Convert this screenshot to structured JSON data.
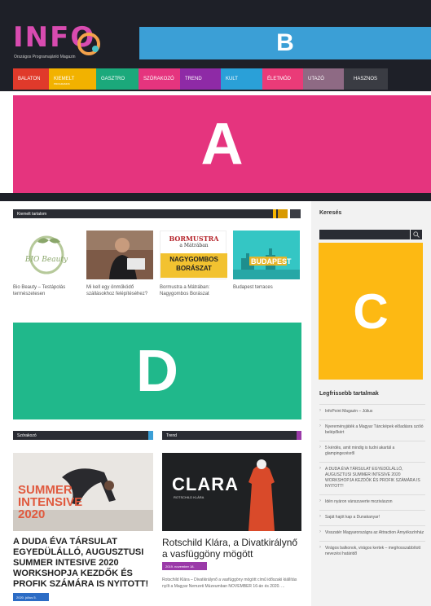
{
  "header": {
    "logo_text": "INFO",
    "logo_subtitle": "Országos Programajánló Magazin",
    "banner_b_label": "B",
    "banner_a_label": "A"
  },
  "nav": [
    {
      "label": "BALATON",
      "color": "#e03a2b"
    },
    {
      "label": "KIEMELT",
      "sub": "PROGRAMOK",
      "color": "#f2b200"
    },
    {
      "label": "GASZTRO",
      "color": "#1ba97b"
    },
    {
      "label": "SZÓRAKOZÓ",
      "color": "#e5347e"
    },
    {
      "label": "TREND",
      "color": "#8e2aa6"
    },
    {
      "label": "KULT",
      "color": "#2aa0d8"
    },
    {
      "label": "ÉLETMÓD",
      "color": "#ea3b78"
    },
    {
      "label": "UTAZÓ",
      "color": "#8e6a84"
    },
    {
      "label": "HASZNOS",
      "color": "#3a3c43"
    }
  ],
  "main": {
    "featured_title": "Kiemelt tartalom",
    "thumbs": [
      {
        "caption": "Bio Beauty – Testápolás természetesen",
        "image_text": "BIO Beauty"
      },
      {
        "caption": "Mi kell egy önműködő szállásokhoz felépítéséhez?",
        "image_text": ""
      },
      {
        "caption": "Bormustra a Mátrában: Nagygombos Borászat",
        "image_text_1": "BORMUSTRA",
        "image_text_2": "a Mátrában",
        "image_text_3": "NAGYGOMBOS",
        "image_text_4": "BORÁSZAT"
      },
      {
        "caption": "Budapest terraces",
        "image_text": "BUDAPEST"
      }
    ],
    "banner_d_label": "D",
    "section_left": "Szórakozó",
    "section_right": "Trend",
    "article_left": {
      "image_text_1": "SUMMER",
      "image_text_2": "INTENSIVE",
      "image_text_3": "2020",
      "title": "A DUDA ÉVA TÁRSULAT EGYEDÜLÁLLÓ, AUGUSZTUSI SUMMER INTESIVE 2020 WORKSHOPJA KEZDŐK ÉS PROFIK SZÁMÁRA IS NYITOTT!",
      "date": "2020. július 5."
    },
    "article_right": {
      "image_text_1": "CLARA",
      "image_text_2": "ROTSCHILD KLÁRA",
      "title": "Rotschild Klára, a Divatkirálynő a vasfüggöny mögött",
      "date": "2019. november 18.",
      "excerpt": "Rotschild Klára – Divatkirálynő a vasfüggöny mögött című időszaki kiállítás nyílt a Magyar Nemzeti Múzeumban NOVEMBER 16-án és 2020. ..."
    }
  },
  "sidebar": {
    "search_title": "Keresés",
    "banner_c_label": "C",
    "latest_title": "Legfrissebb tartalmak",
    "latest": [
      "InfoPoint Magazin – Július",
      "Nyereményjáték a Magyar Táncképek előadásra szóló belépőkért",
      "5 kérdés, amit mindig is tudni akartál a glampingezésről",
      "A DUDA ÉVA TÁRSULAT EGYEDÜLÁLLÓ, AUGUSZTUSI SUMMER INTESIVE 2020 WORKSHOPJA KEZDŐK ÉS PROFIK SZÁMÁRA IS NYITOTT!",
      "Idén nyáron vánszuverte mozivászon",
      "Saját hajót kap a Dunakanyar!",
      "Visszatér Magyarországra az Attraction Árnyékszínház",
      "Virágos balkonok, virágos kertek – meghosszabbított nevezési határidő"
    ]
  }
}
